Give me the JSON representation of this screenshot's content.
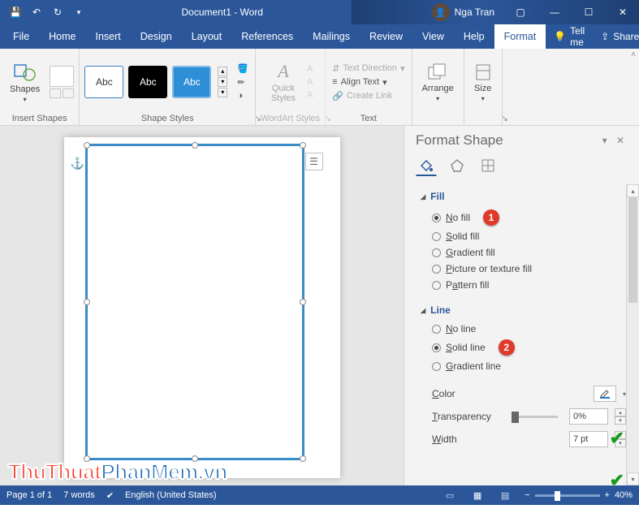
{
  "titlebar": {
    "doc_title": "Document1 - Word",
    "user_name": "Nga Tran"
  },
  "tabs": {
    "items": [
      "File",
      "Home",
      "Insert",
      "Design",
      "Layout",
      "References",
      "Mailings",
      "Review",
      "View",
      "Help",
      "Format"
    ],
    "active": "Format",
    "tell_me": "Tell me",
    "share": "Share"
  },
  "ribbon": {
    "insert_shapes": {
      "label": "Insert Shapes",
      "shapes_btn": "Shapes"
    },
    "shape_styles": {
      "label": "Shape Styles",
      "swatch_text": "Abc"
    },
    "wordart": {
      "label": "WordArt Styles",
      "quick_styles": "Quick\nStyles"
    },
    "text_group": {
      "label": "Text",
      "text_direction": "Text Direction",
      "align_text": "Align Text",
      "create_link": "Create Link"
    },
    "arrange": {
      "label": "Arrange"
    },
    "size": {
      "label": "Size"
    }
  },
  "pane": {
    "title": "Format Shape",
    "fill": {
      "header": "Fill",
      "options": [
        "No fill",
        "Solid fill",
        "Gradient fill",
        "Picture or texture fill",
        "Pattern fill"
      ],
      "selected": 0,
      "badge": "1"
    },
    "line": {
      "header": "Line",
      "options": [
        "No line",
        "Solid line",
        "Gradient line"
      ],
      "selected": 1,
      "badge": "2",
      "color_label": "Color",
      "transparency_label": "Transparency",
      "transparency_value": "0%",
      "width_label": "Width",
      "width_value": "7 pt"
    }
  },
  "statusbar": {
    "page": "Page 1 of 1",
    "words": "7 words",
    "language": "English (United States)",
    "zoom": "40%"
  },
  "watermark": {
    "a": "ThuThuat",
    "b": "PhanMem.vn"
  }
}
